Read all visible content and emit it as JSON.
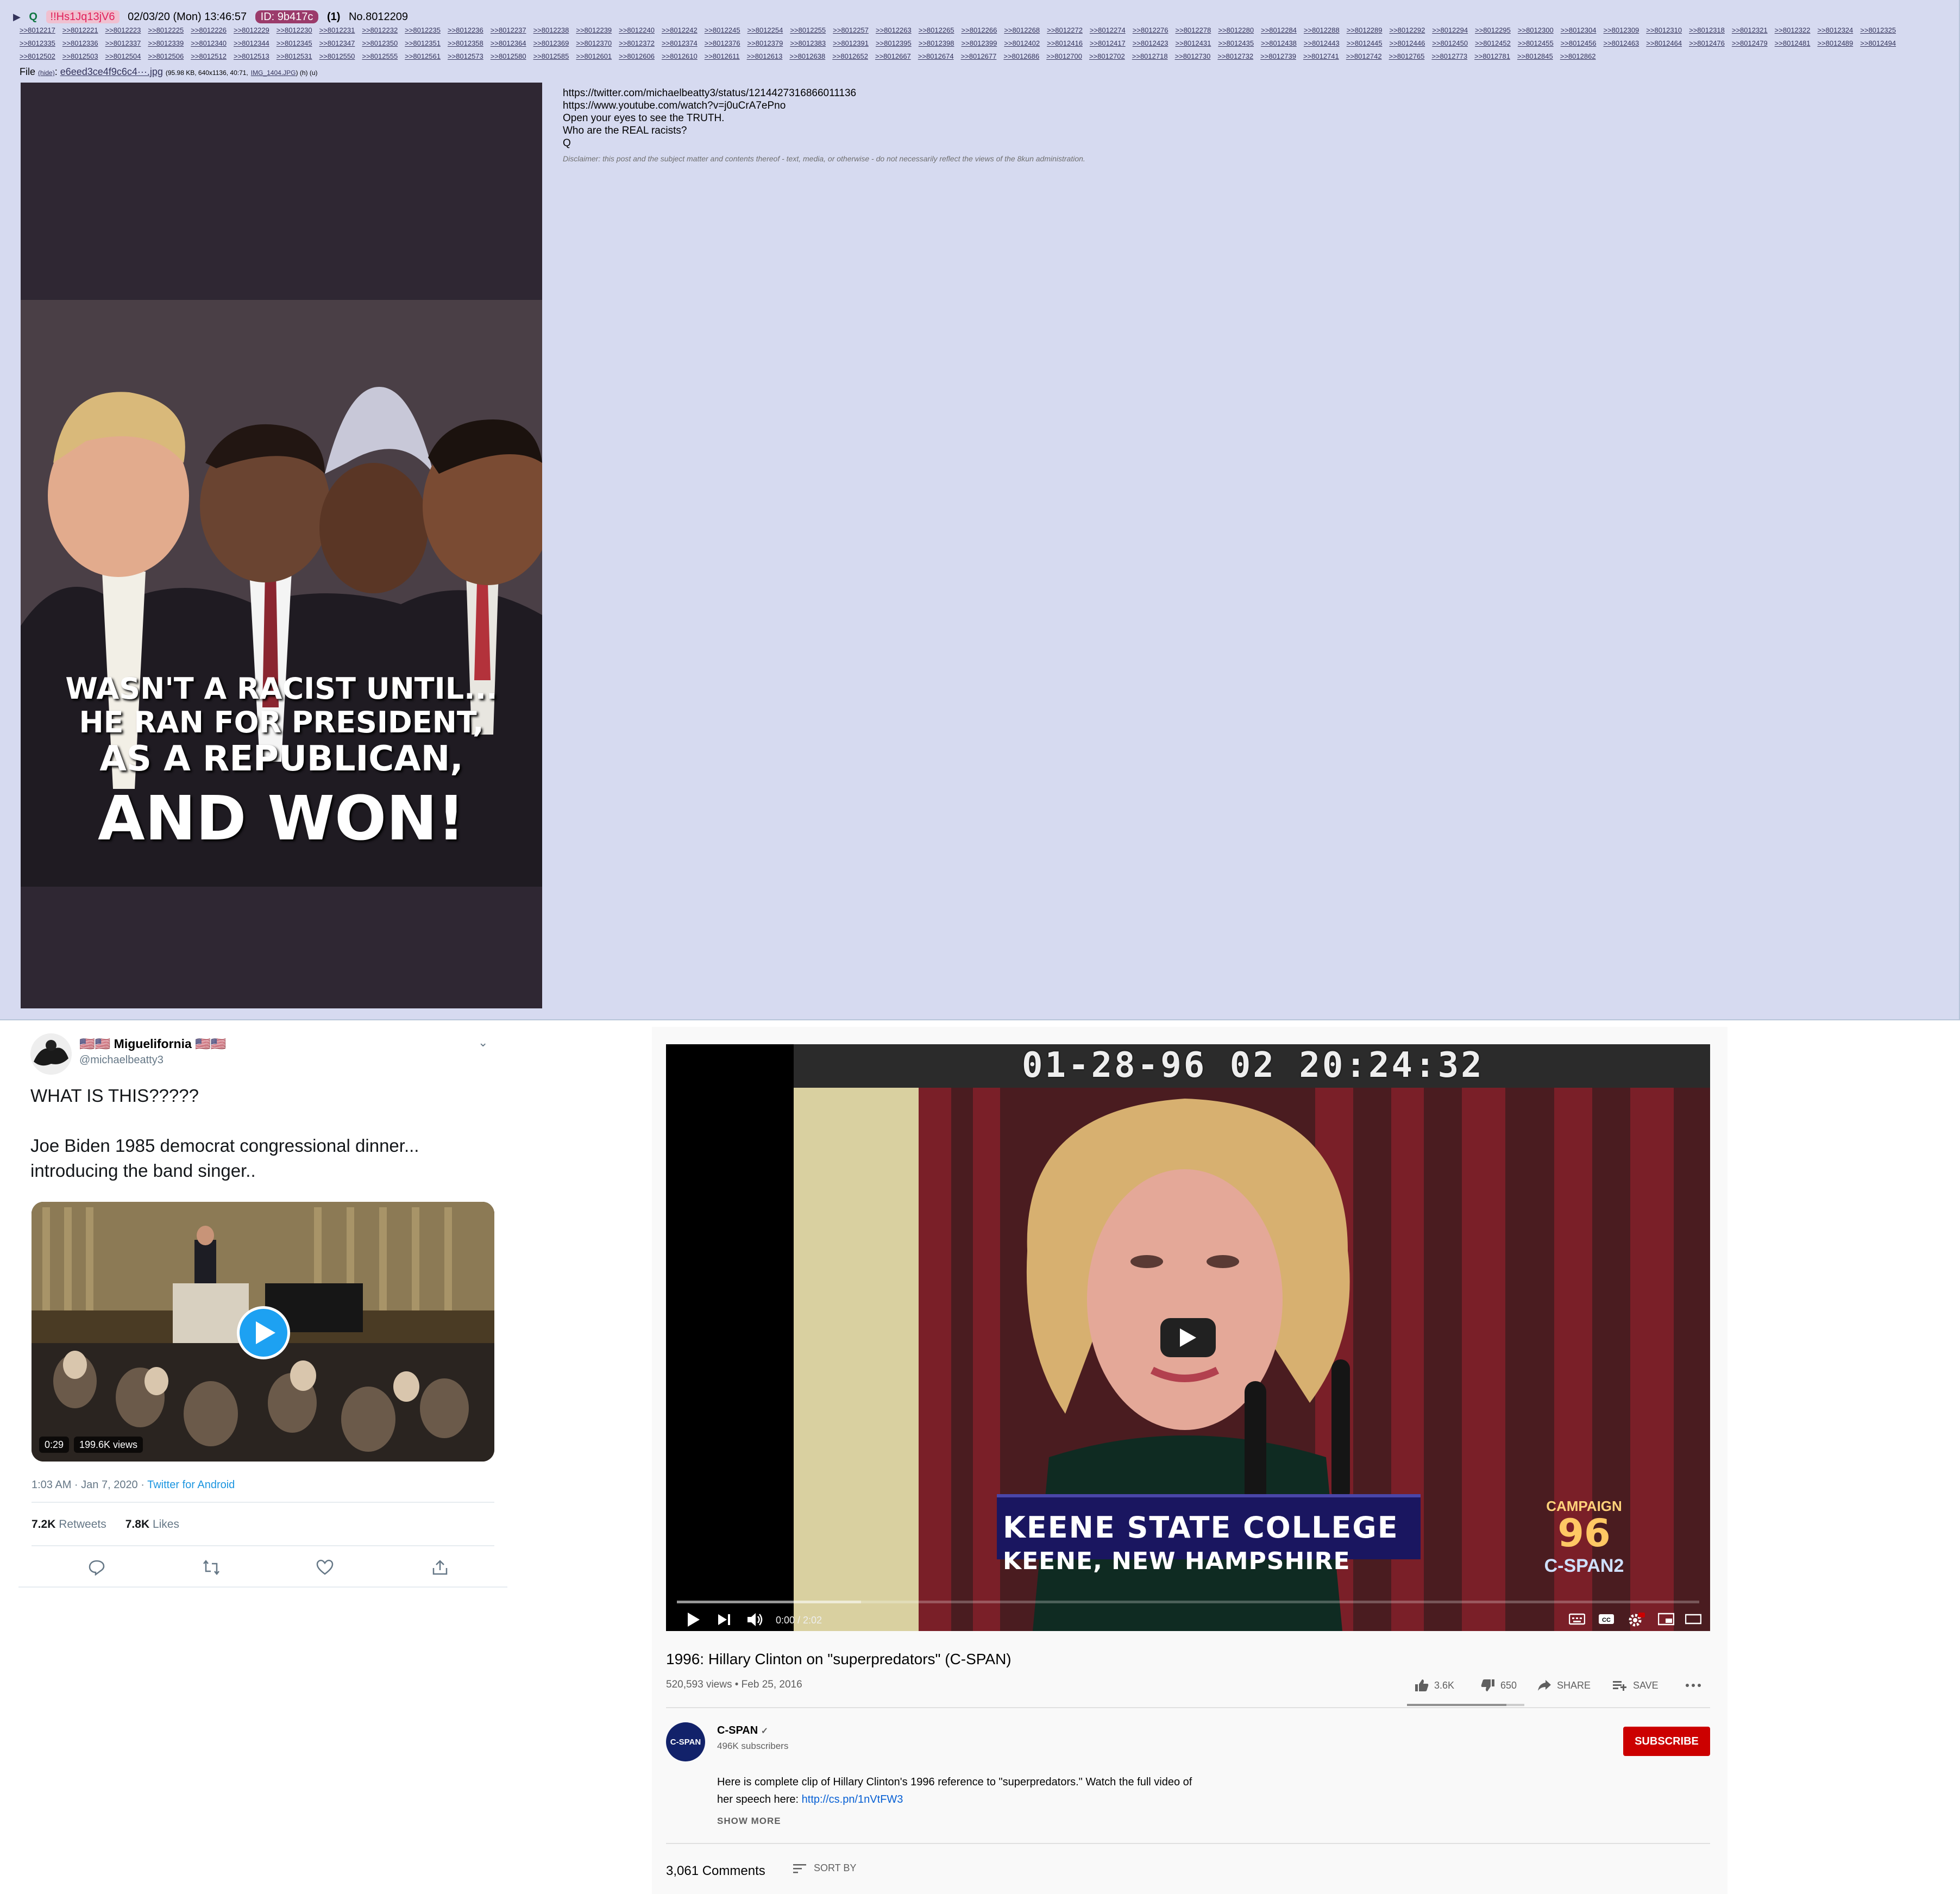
{
  "post": {
    "icon_q": "Q",
    "tripcode": "!!Hs1Jq13jV6",
    "datetime": "02/03/20 (Mon) 13:46:57",
    "id_label": "ID: 9b417c",
    "id_count": "(1)",
    "post_number": "No.8012209",
    "backlinks": [
      ">>8012217",
      ">>8012221",
      ">>8012223",
      ">>8012225",
      ">>8012226",
      ">>8012229",
      ">>8012230",
      ">>8012231",
      ">>8012232",
      ">>8012235",
      ">>8012236",
      ">>8012237",
      ">>8012238",
      ">>8012239",
      ">>8012240",
      ">>8012242",
      ">>8012245",
      ">>8012254",
      ">>8012255",
      ">>8012257",
      ">>8012263",
      ">>8012265",
      ">>8012266",
      ">>8012268",
      ">>8012272",
      ">>8012274",
      ">>8012276",
      ">>8012278",
      ">>8012280",
      ">>8012284",
      ">>8012288",
      ">>8012289",
      ">>8012292",
      ">>8012294",
      ">>8012295",
      ">>8012300",
      ">>8012304",
      ">>8012309",
      ">>8012310",
      ">>8012318",
      ">>8012321",
      ">>8012322",
      ">>8012324",
      ">>8012325",
      ">>8012335",
      ">>8012336",
      ">>8012337",
      ">>8012339",
      ">>8012340",
      ">>8012344",
      ">>8012345",
      ">>8012347",
      ">>8012350",
      ">>8012351",
      ">>8012358",
      ">>8012364",
      ">>8012369",
      ">>8012370",
      ">>8012372",
      ">>8012374",
      ">>8012376",
      ">>8012379",
      ">>8012383",
      ">>8012391",
      ">>8012395",
      ">>8012398",
      ">>8012399",
      ">>8012402",
      ">>8012416",
      ">>8012417",
      ">>8012423",
      ">>8012431",
      ">>8012435",
      ">>8012438",
      ">>8012443",
      ">>8012445",
      ">>8012446",
      ">>8012450",
      ">>8012452",
      ">>8012455",
      ">>8012456",
      ">>8012463",
      ">>8012464",
      ">>8012476",
      ">>8012479",
      ">>8012481",
      ">>8012489",
      ">>8012494",
      ">>8012502",
      ">>8012503",
      ">>8012504",
      ">>8012506",
      ">>8012512",
      ">>8012513",
      ">>8012531",
      ">>8012550",
      ">>8012555",
      ">>8012561",
      ">>8012573",
      ">>8012580",
      ">>8012585",
      ">>8012601",
      ">>8012606",
      ">>8012610",
      ">>8012611",
      ">>8012613",
      ">>8012638",
      ">>8012652",
      ">>8012667",
      ">>8012674",
      ">>8012677",
      ">>8012686",
      ">>8012700",
      ">>8012702",
      ">>8012718",
      ">>8012730",
      ">>8012732",
      ">>8012739",
      ">>8012741",
      ">>8012742",
      ">>8012765",
      ">>8012773",
      ">>8012781",
      ">>8012845",
      ">>8012862"
    ],
    "file": {
      "label": "File",
      "hide": "(hide)",
      "name": "e6eed3ce4f9c6c4···.jpg",
      "details": "(95.98 KB, 640x1136, 40:71,",
      "original_name": "IMG_1404.JPG",
      "links": ") (h) (u)"
    },
    "image_text": [
      "WASN'T A RACIST UNTIL...",
      "HE RAN FOR PRESIDENT,",
      "AS A REPUBLICAN,",
      "AND WON!"
    ],
    "body_lines": [
      "https://twitter.com/michaelbeatty3/status/1214427316866011136",
      "https://www.youtube.com/watch?v=j0uCrA7ePno",
      "Open your eyes to see the TRUTH.",
      "Who are the REAL racists?",
      "Q"
    ],
    "disclaimer": "Disclaimer: this post and the subject matter and contents thereof - text, media, or otherwise - do not necessarily reflect the views of the 8kun administration."
  },
  "tweet": {
    "display_name": "🇺🇸🇺🇸 Miguelifornia 🇺🇸🇺🇸",
    "handle": "@michaelbeatty3",
    "text_line1": "WHAT IS THIS?????",
    "text_line2": "Joe Biden 1985 democrat congressional dinner... introducing the band singer..",
    "video_duration": "0:29",
    "video_views": "199.6K views",
    "timestamp": "1:03 AM · Jan 7, 2020 · ",
    "source": "Twitter for Android",
    "retweets_count": "7.2K",
    "retweets_label": " Retweets",
    "likes_count": "7.8K",
    "likes_label": " Likes",
    "colors": {
      "accent": "#1da1f2",
      "link": "#1b95e0"
    }
  },
  "youtube": {
    "overlay_timestamp": "01-28-96 02 20:24:32",
    "chyron_line1": "KEENE STATE COLLEGE",
    "chyron_line2": "KEENE, NEW HAMPSHIRE",
    "logo_top": "CAMPAIGN",
    "logo_year": "96",
    "logo_network": "C-SPAN2",
    "time_display": "0:00 / 2:02",
    "progress": 0.0,
    "title": "1996: Hillary Clinton on \"superpredators\" (C-SPAN)",
    "views_date": "520,593 views • Feb 25, 2016",
    "likes": "3.6K",
    "dislikes": "650",
    "share_label": "SHARE",
    "save_label": "SAVE",
    "channel_avatar_text": "C-SPAN",
    "channel_name": "C-SPAN",
    "subscribers": "496K subscribers",
    "subscribe_label": "SUBSCRIBE",
    "description_line1": "Here is complete clip of Hillary Clinton's 1996 reference to \"superpredators.\" Watch the full video of",
    "description_line2_prefix": "her speech here: ",
    "description_link": "http://cs.pn/1nVtFW3",
    "show_more": "SHOW MORE",
    "comments_count": "3,061 Comments",
    "sort_by": "SORT BY",
    "colors": {
      "subscribe": "#cc0000",
      "link": "#065fd4"
    }
  }
}
